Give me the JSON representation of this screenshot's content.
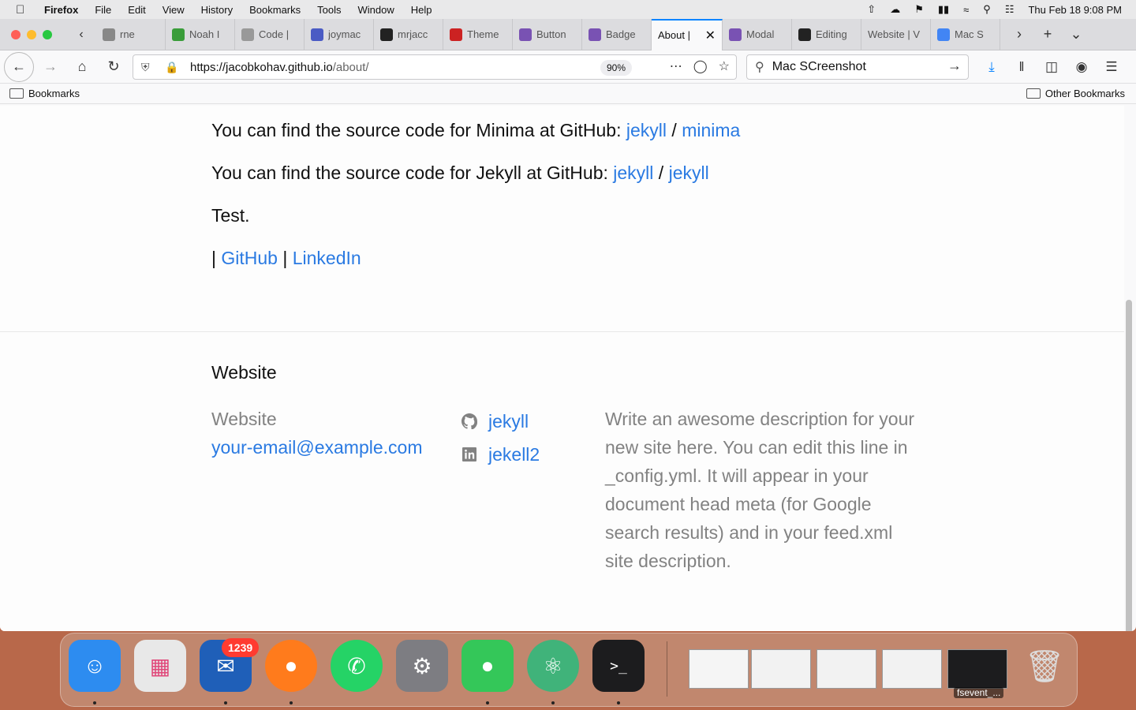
{
  "menubar": {
    "app": "Firefox",
    "items": [
      "File",
      "Edit",
      "View",
      "History",
      "Bookmarks",
      "Tools",
      "Window",
      "Help"
    ],
    "clock": "Thu Feb 18  9:08 PM"
  },
  "tabs": [
    {
      "label": "rne",
      "color": "#888888",
      "icon": "page-icon"
    },
    {
      "label": "Noah I",
      "color": "#3a9d3a",
      "icon": "noah-favicon"
    },
    {
      "label": "Code |",
      "color": "#999999",
      "icon": "code-favicon"
    },
    {
      "label": "joymac",
      "color": "#4a5bc4",
      "icon": "joymac-favicon"
    },
    {
      "label": "mrjacc",
      "color": "#222222",
      "icon": "github-icon"
    },
    {
      "label": "Theme",
      "color": "#cc2222",
      "icon": "theme-favicon"
    },
    {
      "label": "Button",
      "color": "#7952b3",
      "icon": "bootstrap-icon"
    },
    {
      "label": "Badge",
      "color": "#7952b3",
      "icon": "bootstrap-icon"
    },
    {
      "label": "About |",
      "color": "",
      "icon": "",
      "active": true
    },
    {
      "label": "Modal",
      "color": "#7952b3",
      "icon": "bootstrap-icon"
    },
    {
      "label": "Editing",
      "color": "#222222",
      "icon": "github-icon"
    },
    {
      "label": "Website | V",
      "color": "",
      "icon": ""
    },
    {
      "label": "Mac S",
      "color": "#4285f4",
      "icon": "google-icon"
    }
  ],
  "urlbar": {
    "host": "https://jacobkohav.github.io",
    "path": "/about/",
    "zoom": "90%"
  },
  "search": {
    "value": "Mac SCreenshot"
  },
  "bookmarks": {
    "left": "Bookmarks",
    "right": "Other Bookmarks"
  },
  "page": {
    "minima_line": "You can find the source code for Minima at GitHub: ",
    "minima_link1": "jekyll",
    "minima_link2": "minima",
    "jekyll_line": "You can find the source code for Jekyll at GitHub: ",
    "jekyll_link1": "jekyll",
    "jekyll_link2": "jekyll",
    "slash": " / ",
    "test": "Test.",
    "sep": "|",
    "link_github": "GitHub",
    "link_linkedin": "LinkedIn"
  },
  "footer": {
    "heading": "Website",
    "site_name": "Website",
    "email": "your-email@example.com",
    "github_user": "jekyll",
    "linkedin_user": "jekell2",
    "description": "Write an awesome description for your new site here. You can edit this line in _config.yml. It will appear in your document head meta (for Google search results) and in your feed.xml site description."
  },
  "dock": {
    "mail_badge": "1239",
    "window_label": "fsevent_..."
  }
}
